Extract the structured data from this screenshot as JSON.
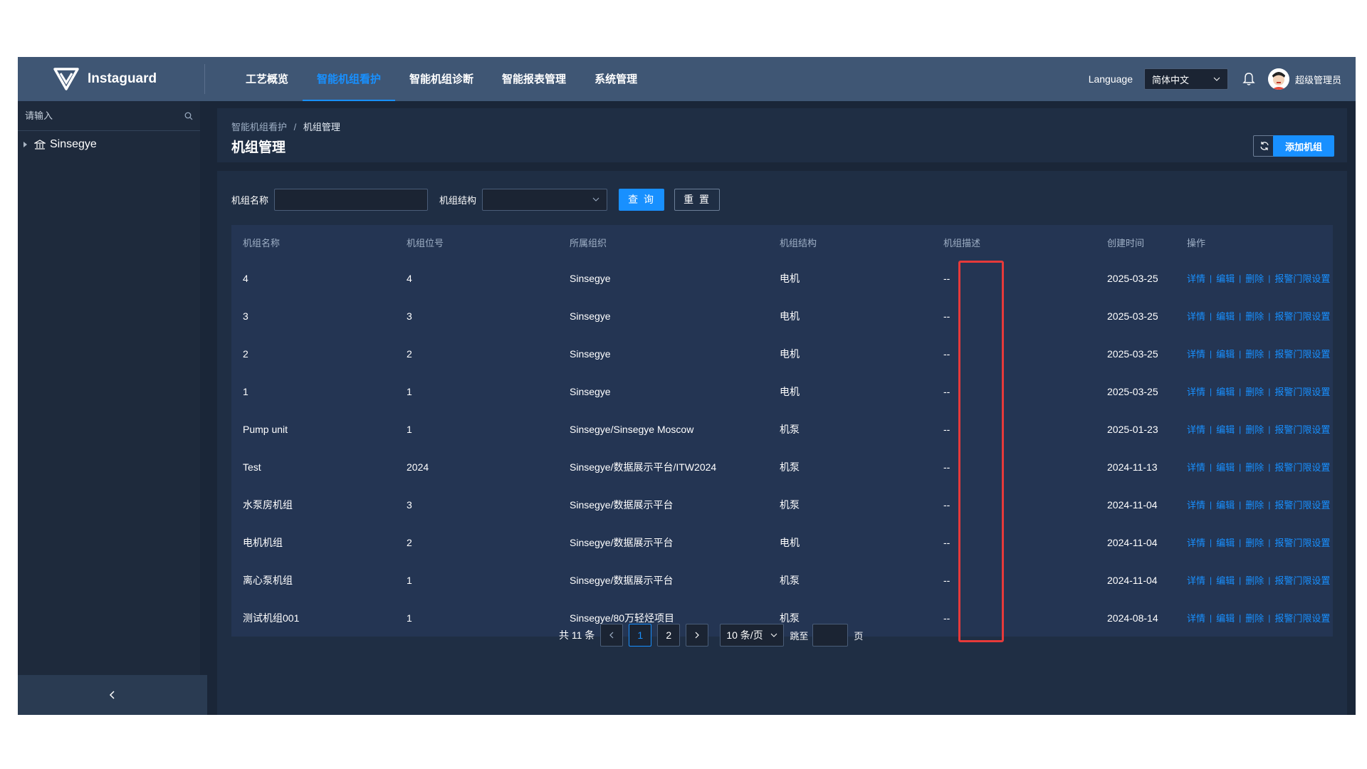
{
  "app": {
    "name": "Instaguard"
  },
  "nav": {
    "items": [
      {
        "label": "工艺概览",
        "active": false
      },
      {
        "label": "智能机组看护",
        "active": true
      },
      {
        "label": "智能机组诊断",
        "active": false
      },
      {
        "label": "智能报表管理",
        "active": false
      },
      {
        "label": "系统管理",
        "active": false
      }
    ]
  },
  "topbar": {
    "language_label": "Language",
    "language_value": "简体中文",
    "user_name": "超级管理员"
  },
  "sidebar": {
    "search_placeholder": "请输入",
    "tree_root": "Sinsegye"
  },
  "breadcrumb": {
    "parent": "智能机组看护",
    "separator": "/",
    "current": "机组管理"
  },
  "page": {
    "title": "机组管理",
    "add_button": "添加机组"
  },
  "filters": {
    "name_label": "机组名称",
    "structure_label": "机组结构",
    "query_button": "查 询",
    "reset_button": "重 置"
  },
  "table": {
    "headers": {
      "name": "机组名称",
      "position": "机组位号",
      "org": "所属组织",
      "structure": "机组结构",
      "desc": "机组描述",
      "created": "创建时间",
      "ops": "操作"
    },
    "op_labels": {
      "detail": "详情",
      "edit": "编辑",
      "delete": "删除",
      "alarm": "报警门限设置",
      "sep": "|"
    },
    "rows": [
      {
        "name": "4",
        "position": "4",
        "org": "Sinsegye",
        "structure": "电机",
        "desc": "--",
        "created": "2025-03-25"
      },
      {
        "name": "3",
        "position": "3",
        "org": "Sinsegye",
        "structure": "电机",
        "desc": "--",
        "created": "2025-03-25"
      },
      {
        "name": "2",
        "position": "2",
        "org": "Sinsegye",
        "structure": "电机",
        "desc": "--",
        "created": "2025-03-25"
      },
      {
        "name": "1",
        "position": "1",
        "org": "Sinsegye",
        "structure": "电机",
        "desc": "--",
        "created": "2025-03-25"
      },
      {
        "name": "Pump unit",
        "position": "1",
        "org": "Sinsegye/Sinsegye Moscow",
        "structure": "机泵",
        "desc": "--",
        "created": "2025-01-23"
      },
      {
        "name": "Test",
        "position": "2024",
        "org": "Sinsegye/数据展示平台/ITW2024",
        "structure": "机泵",
        "desc": "--",
        "created": "2024-11-13"
      },
      {
        "name": "水泵房机组",
        "position": "3",
        "org": "Sinsegye/数据展示平台",
        "structure": "机泵",
        "desc": "--",
        "created": "2024-11-04"
      },
      {
        "name": "电机机组",
        "position": "2",
        "org": "Sinsegye/数据展示平台",
        "structure": "电机",
        "desc": "--",
        "created": "2024-11-04"
      },
      {
        "name": "离心泵机组",
        "position": "1",
        "org": "Sinsegye/数据展示平台",
        "structure": "机泵",
        "desc": "--",
        "created": "2024-11-04"
      },
      {
        "name": "测试机组001",
        "position": "1",
        "org": "Sinsegye/80万轻烃项目",
        "structure": "机泵",
        "desc": "--",
        "created": "2024-08-14"
      }
    ]
  },
  "pagination": {
    "total": "共 11 条",
    "pages": [
      "1",
      "2"
    ],
    "current_page": "1",
    "page_size": "10 条/页",
    "jump_label": "跳至",
    "page_suffix": "页"
  },
  "colors": {
    "accent": "#1890ff",
    "highlight": "#e63a3a",
    "topbar": "#3f5674"
  }
}
